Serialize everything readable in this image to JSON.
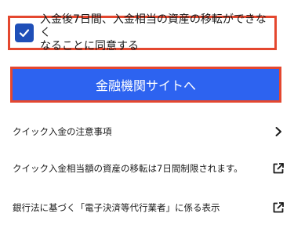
{
  "consent": {
    "checked": true,
    "text": "入金後7日間、入金相当の資産の移転ができなく\nなることに同意する"
  },
  "bank_button": {
    "label": "金融機関サイトへ"
  },
  "links": [
    {
      "label": "クイック入金の注意事項",
      "icon": "chevron-right-icon"
    },
    {
      "label": "クイック入金相当額の資産の移転は7日間制限されます。",
      "icon": "external-link-icon"
    },
    {
      "label": "銀行法に基づく「電子決済等代行業者」に係る表示",
      "icon": "external-link-icon"
    }
  ],
  "colors": {
    "accent_blue": "#2d63f0",
    "checkbox_blue": "#1f4fb8",
    "highlight_red": "#e4472f"
  }
}
